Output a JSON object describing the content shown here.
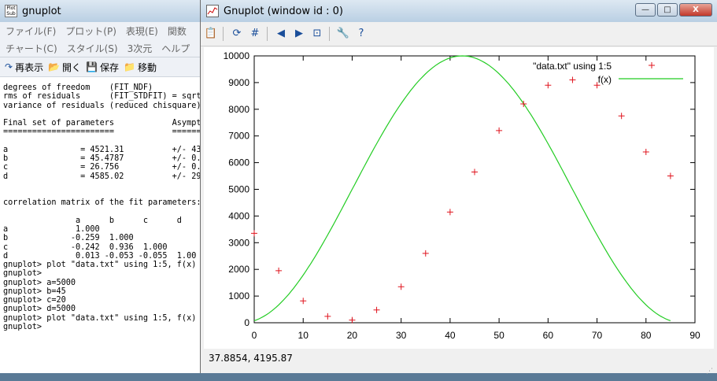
{
  "console": {
    "title": "gnuplot",
    "app_icon_text": "Plot Sub",
    "menu_row1": [
      "ファイル(F)",
      "プロット(P)",
      "表現(E)",
      "関数"
    ],
    "menu_row2": [
      "チャート(C)",
      "スタイル(S)",
      "3次元",
      "ヘルプ"
    ],
    "toolbar": [
      {
        "icon": "redisplay-icon",
        "glyph": "↷",
        "label": "再表示"
      },
      {
        "icon": "open-folder-icon",
        "glyph": "📂",
        "label": "開く"
      },
      {
        "icon": "save-icon",
        "glyph": "💾",
        "label": "保存"
      },
      {
        "icon": "move-icon",
        "glyph": "📁",
        "label": "移動"
      }
    ],
    "lines": [
      "degrees of freedom    (FIT_NDF)",
      "rms of residuals      (FIT_STDFIT) = sqrt",
      "variance of residuals (reduced chisquare)",
      "",
      "Final set of parameters            Asympt",
      "=======================            ======",
      "",
      "a               = 4521.31          +/- 43",
      "b               = 45.4787          +/- 0.",
      "c               = 26.756           +/- 0.",
      "d               = 4585.02          +/- 29",
      "",
      "",
      "correlation matrix of the fit parameters:",
      "",
      "               a      b      c      d",
      "a              1.000",
      "b             -0.259  1.000",
      "c             -0.242  0.936  1.000",
      "d              0.013 -0.053 -0.055  1.00",
      "gnuplot> plot \"data.txt\" using 1:5, f(x)",
      "gnuplot>",
      "gnuplot> a=5000",
      "gnuplot> b=45",
      "gnuplot> c=20",
      "gnuplot> d=5000",
      "gnuplot> plot \"data.txt\" using 1:5, f(x)",
      "gnuplot>"
    ]
  },
  "gnuplot_window": {
    "title": "Gnuplot (window id : 0)",
    "caption_buttons": {
      "minimize": "—",
      "maximize": "□",
      "close": "X"
    },
    "toolbar_icons": [
      {
        "name": "copy-clipboard-icon",
        "glyph": "📋"
      },
      {
        "name": "replot-icon",
        "glyph": "⟳"
      },
      {
        "name": "grid-icon",
        "glyph": "#"
      },
      {
        "name": "zoom-previous-icon",
        "glyph": "◀"
      },
      {
        "name": "zoom-next-icon",
        "glyph": "▶"
      },
      {
        "name": "autoscale-icon",
        "glyph": "⊡"
      },
      {
        "name": "options-wrench-icon",
        "glyph": "🔧"
      },
      {
        "name": "help-icon",
        "glyph": "?"
      }
    ],
    "status": "37.8854,  4195.87",
    "grip": "⋰"
  },
  "colors": {
    "data_points": "#e0141e",
    "fit_curve": "#22cc22",
    "border": "#000000"
  },
  "chart_data": {
    "type": "scatter",
    "xlim": [
      0,
      90
    ],
    "ylim": [
      0,
      10000
    ],
    "xticks": [
      0,
      10,
      20,
      30,
      40,
      50,
      60,
      70,
      80,
      90
    ],
    "yticks": [
      0,
      1000,
      2000,
      3000,
      4000,
      5000,
      6000,
      7000,
      8000,
      9000,
      10000
    ],
    "legend_position": "top-right",
    "grid": false,
    "series": [
      {
        "name": "\"data.txt\" using 1:5",
        "marker": "+",
        "x": [
          0,
          5,
          10,
          15,
          20,
          25,
          30,
          35,
          40,
          45,
          50,
          55,
          60,
          65,
          70,
          75,
          80,
          85
        ],
        "y": [
          3350,
          1950,
          820,
          240,
          100,
          480,
          1350,
          2600,
          4150,
          5650,
          7200,
          8200,
          8900,
          9100,
          8900,
          7750,
          6400,
          5500
        ]
      },
      {
        "name": "f(x)",
        "style": "line",
        "function": {
          "a": 5000,
          "b": 45,
          "c": 20,
          "d": 5000,
          "form": "a*sin(2*pi*(x-c)/(2*b)) + d"
        }
      }
    ]
  }
}
